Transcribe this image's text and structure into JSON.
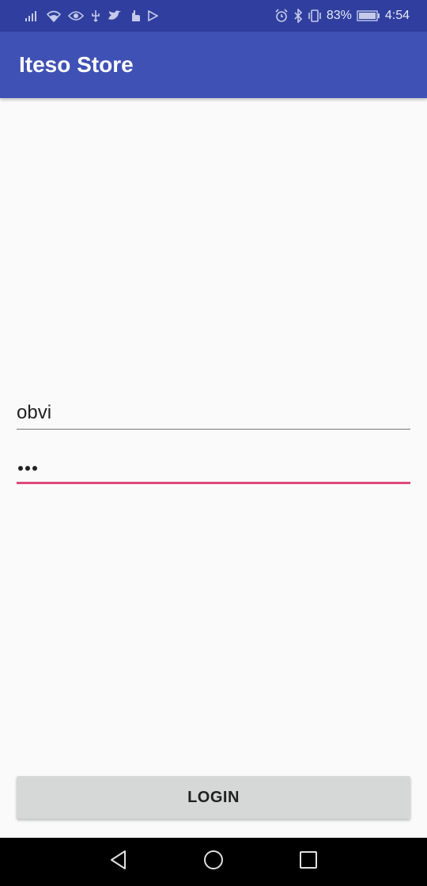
{
  "status_bar": {
    "battery": "83%",
    "time": "4:54",
    "left_icons": [
      "signal-icon",
      "wifi-icon",
      "eye-icon",
      "usb-icon",
      "twitter-icon",
      "hand-icon",
      "play-icon"
    ],
    "right_icons": [
      "alarm-icon",
      "bluetooth-icon",
      "vibrate-icon",
      "battery-icon"
    ]
  },
  "app_bar": {
    "title": "Iteso Store"
  },
  "form": {
    "username_value": "obvi",
    "password_masked": "•••"
  },
  "login_button": {
    "label": "LOGIN"
  },
  "nav_bar": {
    "buttons": [
      "back-icon",
      "home-icon",
      "recents-icon"
    ]
  },
  "colors": {
    "status_bar": "#303f9f",
    "app_bar": "#3f51b5",
    "accent": "#e0487a",
    "button": "#d6d7d7"
  }
}
